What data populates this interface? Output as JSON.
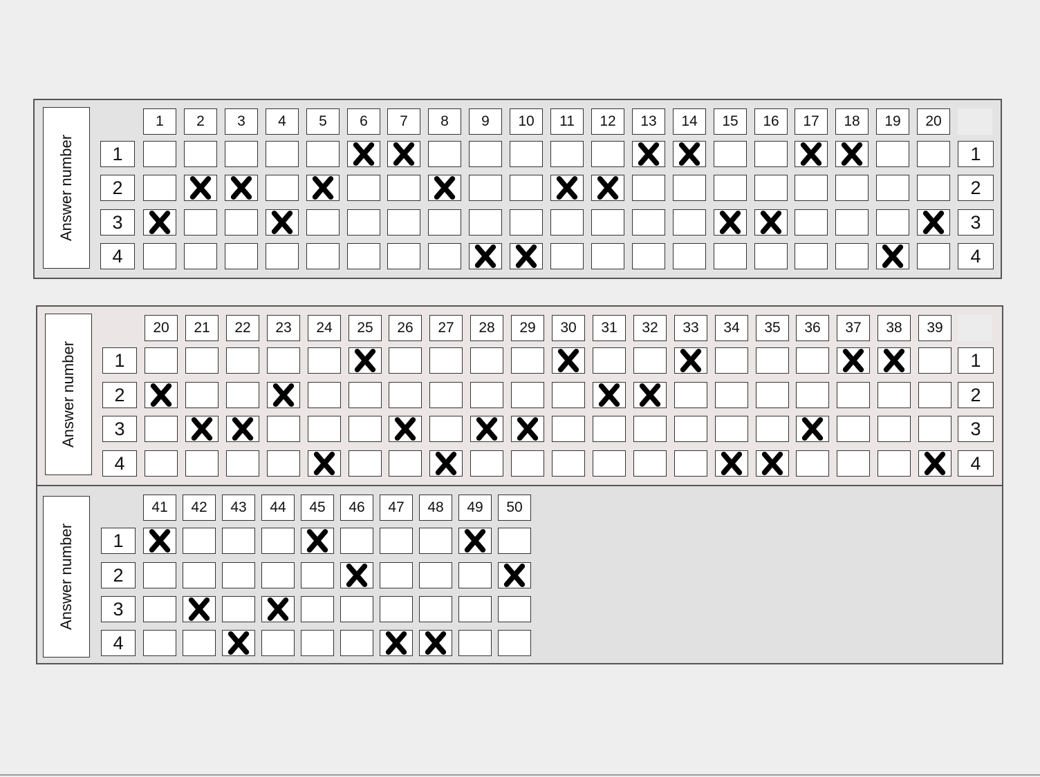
{
  "label": "Answer number",
  "row_labels": [
    "1",
    "2",
    "3",
    "4"
  ],
  "sections": [
    {
      "columns": [
        "1",
        "2",
        "3",
        "4",
        "5",
        "6",
        "7",
        "8",
        "9",
        "10",
        "11",
        "12",
        "13",
        "14",
        "15",
        "16",
        "17",
        "18",
        "19",
        "20"
      ],
      "marked_answers": [
        3,
        2,
        2,
        3,
        2,
        1,
        1,
        2,
        4,
        4,
        2,
        2,
        1,
        1,
        3,
        3,
        1,
        1,
        4,
        3
      ]
    },
    {
      "columns": [
        "20",
        "21",
        "22",
        "23",
        "24",
        "25",
        "26",
        "27",
        "28",
        "29",
        "30",
        "31",
        "32",
        "33",
        "34",
        "35",
        "36",
        "37",
        "38",
        "39"
      ],
      "marked_answers": [
        2,
        3,
        3,
        2,
        4,
        1,
        3,
        4,
        3,
        3,
        1,
        2,
        2,
        1,
        4,
        4,
        3,
        1,
        1,
        4
      ]
    },
    {
      "columns": [
        "41",
        "42",
        "43",
        "44",
        "45",
        "46",
        "47",
        "48",
        "49",
        "50"
      ],
      "marked_answers": [
        1,
        3,
        4,
        3,
        1,
        2,
        4,
        4,
        1,
        2
      ]
    }
  ]
}
